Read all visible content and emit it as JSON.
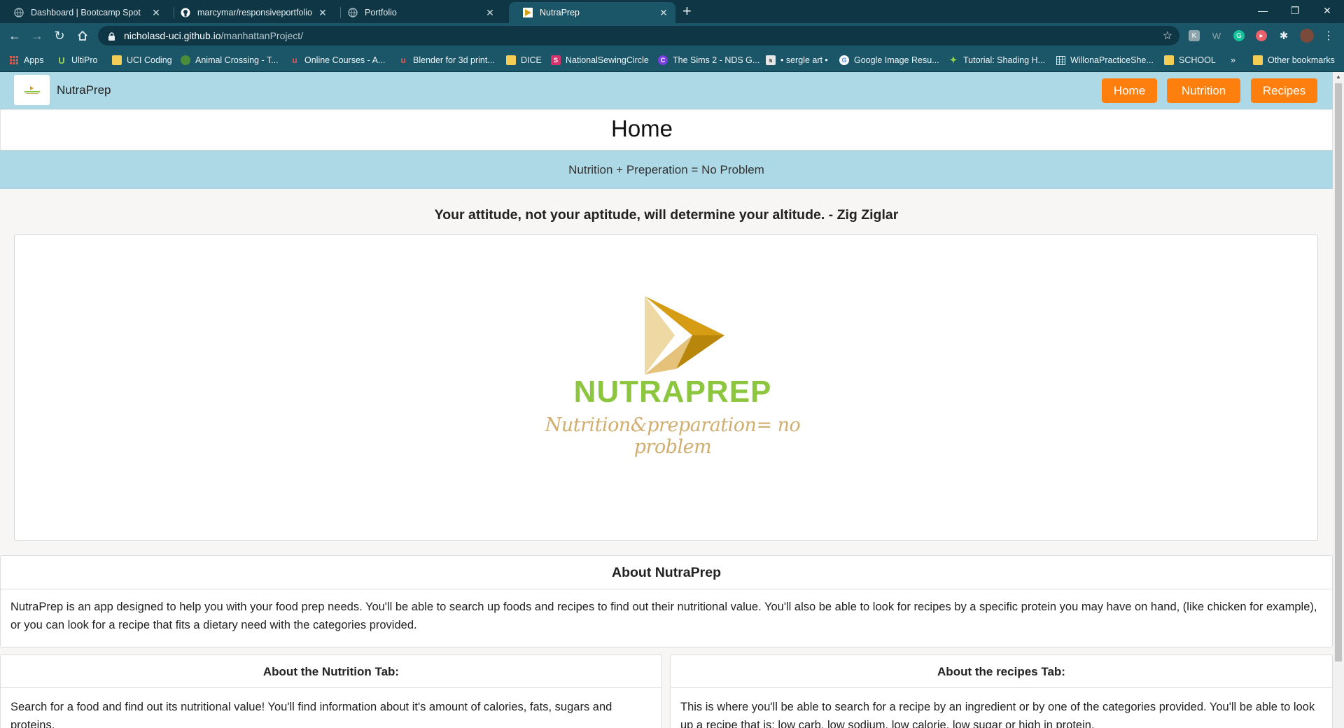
{
  "browser": {
    "tabs": [
      {
        "title": "Dashboard | Bootcamp Spot",
        "active": false,
        "icon": "globe-icon"
      },
      {
        "title": "marcymar/responsiveportfolio",
        "active": false,
        "icon": "github-icon"
      },
      {
        "title": "Portfolio",
        "active": false,
        "icon": "globe-icon"
      },
      {
        "title": "NutraPrep",
        "active": true,
        "icon": "nutraprep-favicon"
      }
    ],
    "url_host": "nicholasd-uci.github.io",
    "url_path": "/manhattanProject/",
    "bookmarks": [
      {
        "label": "Apps",
        "icon": "apps-grid-icon"
      },
      {
        "label": "UltiPro",
        "icon": "ultipro-icon"
      },
      {
        "label": "UCI Coding",
        "icon": "folder-icon"
      },
      {
        "label": "Animal Crossing - T...",
        "icon": "leaf-icon"
      },
      {
        "label": "Online Courses - A...",
        "icon": "courses-icon"
      },
      {
        "label": "Blender for 3d print...",
        "icon": "courses-icon"
      },
      {
        "label": "DICE",
        "icon": "folder-icon"
      },
      {
        "label": "NationalSewingCircle",
        "icon": "sewing-icon"
      },
      {
        "label": "The Sims 2 - NDS G...",
        "icon": "sims-icon"
      },
      {
        "label": "• sergle art •",
        "icon": "sergle-icon"
      },
      {
        "label": "Google Image Resu...",
        "icon": "google-icon"
      },
      {
        "label": "Tutorial: Shading H...",
        "icon": "figure-icon"
      },
      {
        "label": "WillonaPracticeShe...",
        "icon": "sheet-icon"
      },
      {
        "label": "SCHOOL",
        "icon": "folder-icon"
      }
    ],
    "more_bookmarks": "»",
    "other_bookmarks": "Other bookmarks",
    "colors": {
      "chrome_dark": "#0e3645",
      "chrome": "#1a5568"
    }
  },
  "page": {
    "brand": "NutraPrep",
    "nav": [
      "Home",
      "Nutrition",
      "Recipes"
    ],
    "heading": "Home",
    "tagline": "Nutrition + Preperation = No Problem",
    "quote": "Your attitude, not your aptitude, will determine your altitude. - Zig Ziglar",
    "logo": {
      "word": "NUTRAPREP",
      "tagline": "Nutrition&preparation= no problem"
    },
    "about": {
      "title": "About NutraPrep",
      "body": "NutraPrep is an app designed to help you with your food prep needs. You'll be able to search up foods and recipes to find out their nutritional value. You'll also be able to look for recipes by a specific protein you may have on hand, (like chicken for example), or you can look for a recipe that fits a dietary need with the categories provided."
    },
    "nutrition_tab": {
      "title": "About the Nutrition Tab:",
      "body": "Search for a food and find out its nutritional value! You'll find information about it's amount of calories, fats, sugars and proteins."
    },
    "recipes_tab": {
      "title": "About the recipes Tab:",
      "body": "This is where you'll be able to search for a recipe by an ingredient or by one of the categories provided. You'll be able to look up a recipe that is: low carb, low sodium, low calorie, low sugar or high in protein."
    },
    "colors": {
      "navbar": "#add8e6",
      "button": "#ff7f0e",
      "logo_green": "#8cc63e",
      "logo_gold": "#d4a017"
    }
  }
}
